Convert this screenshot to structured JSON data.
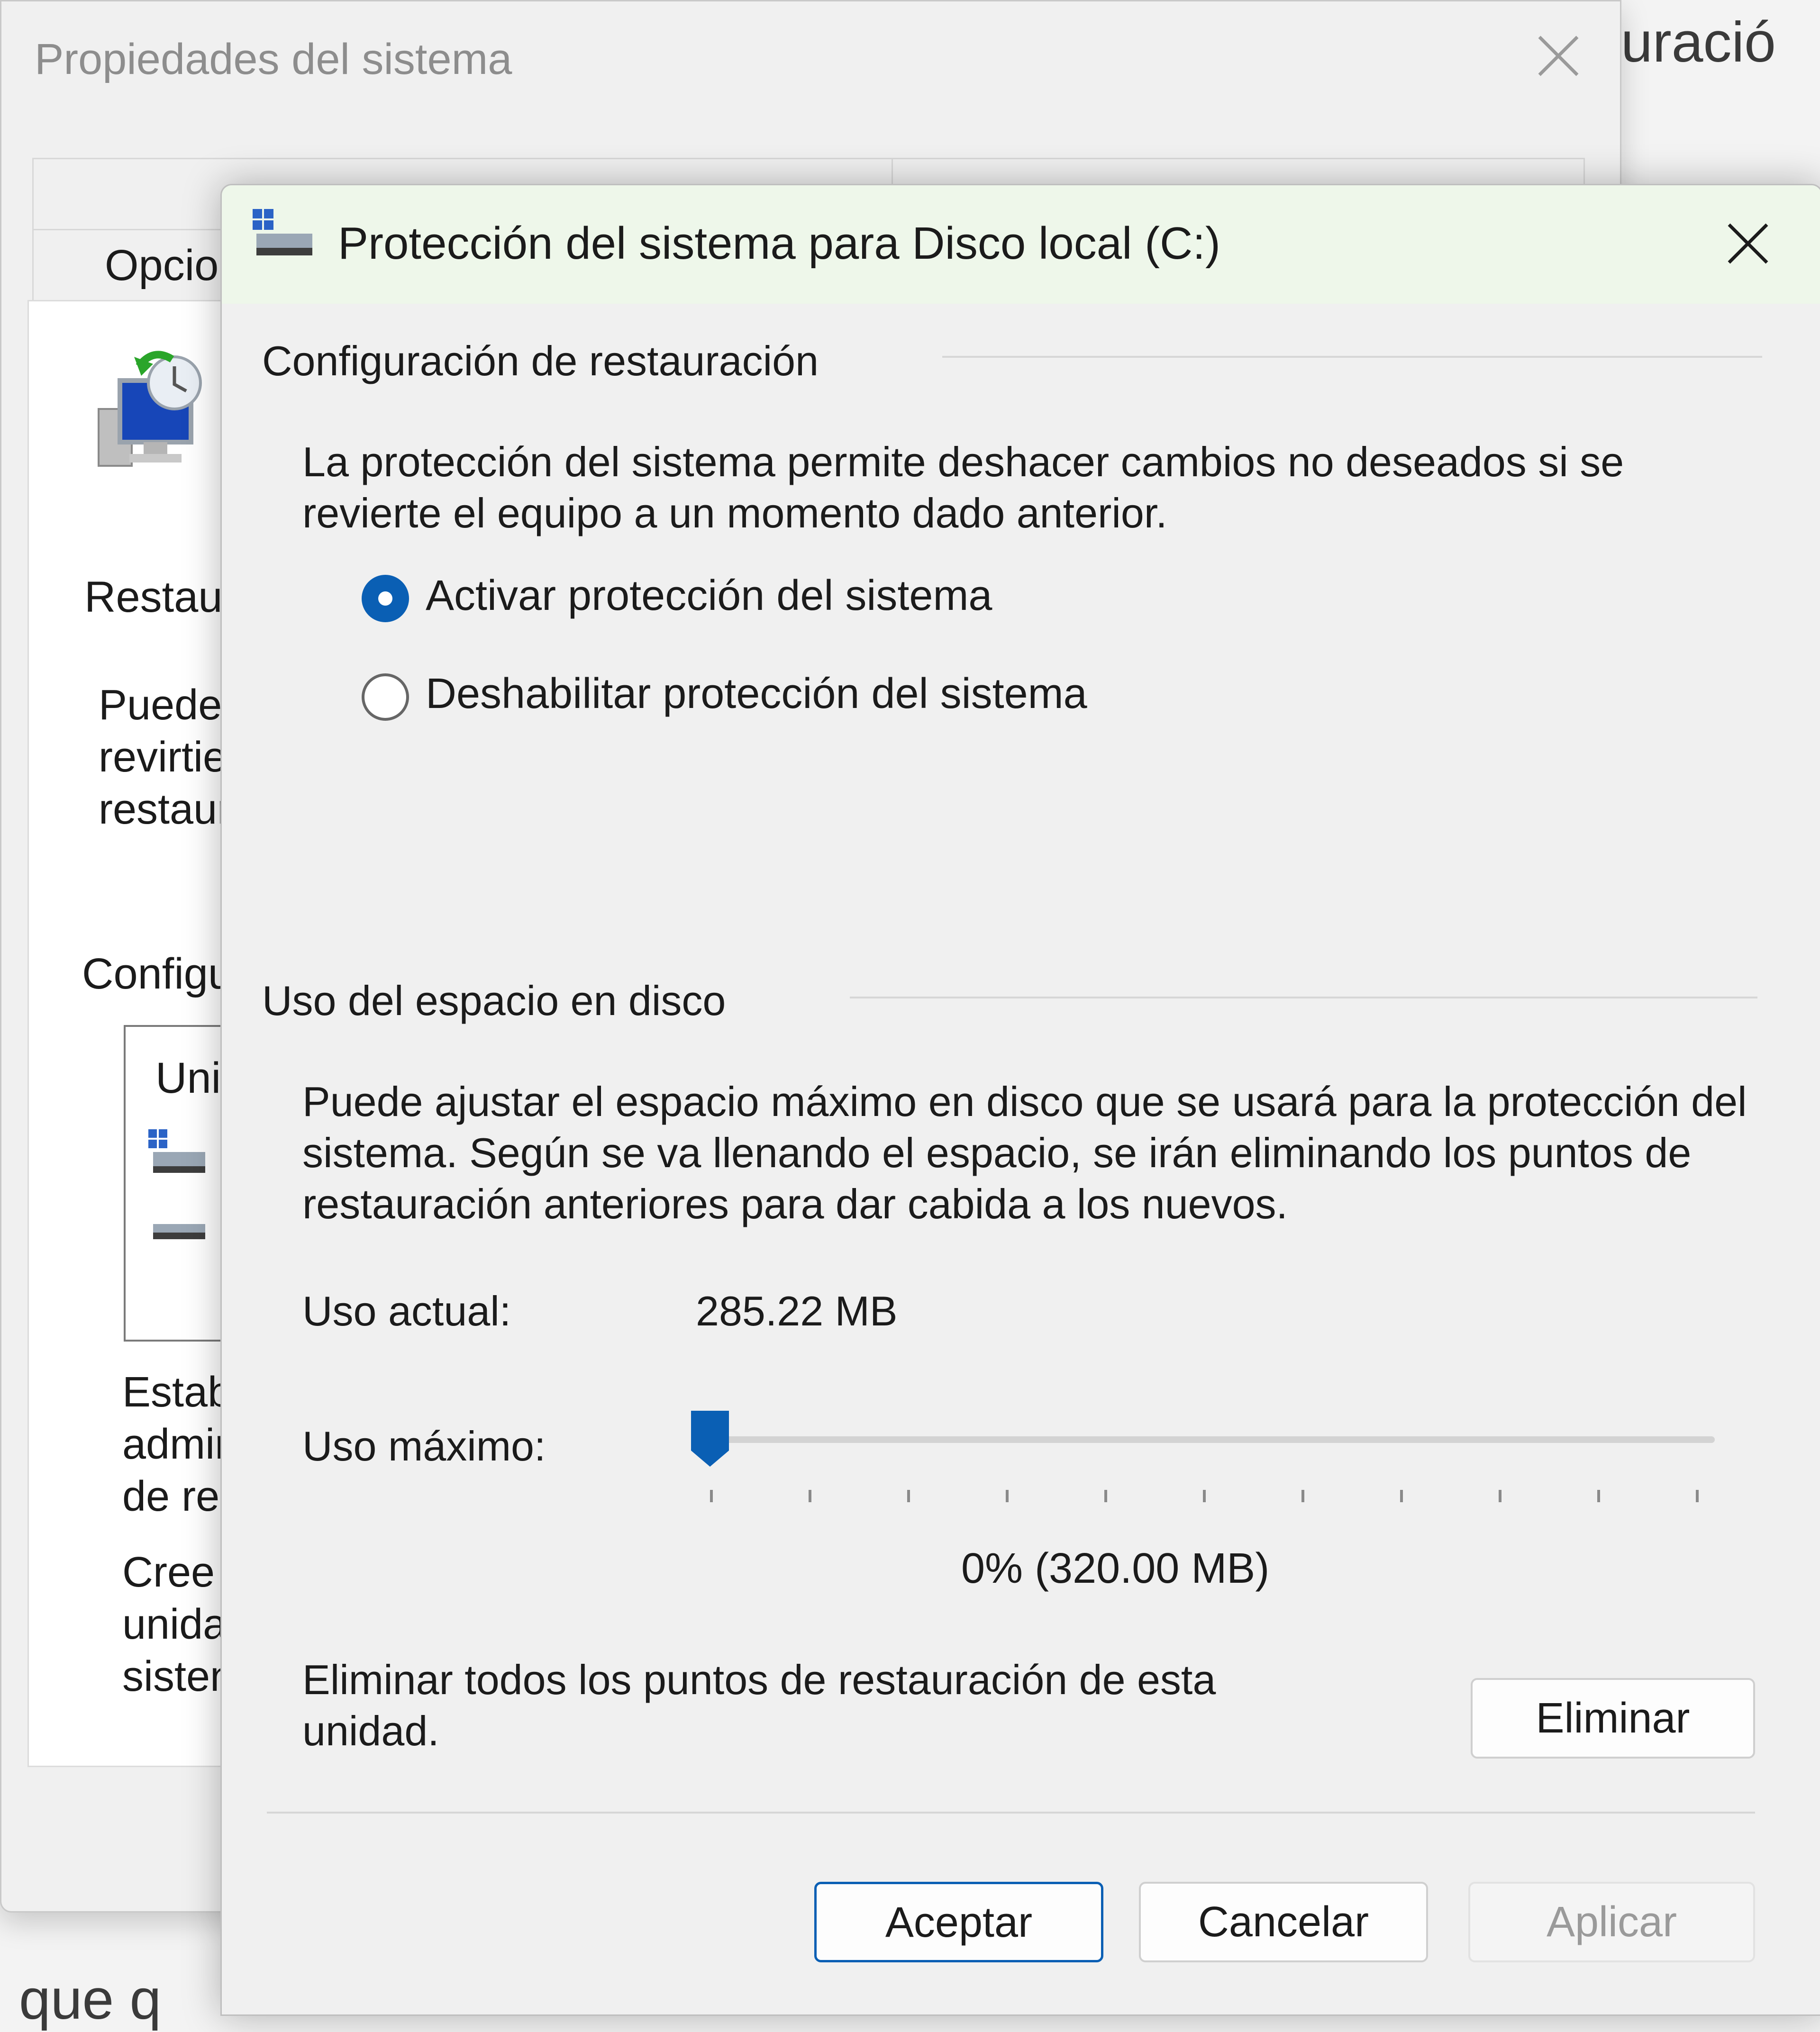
{
  "background": {
    "top_right_text": "uració",
    "bottom_left_text": "que q"
  },
  "parent_window": {
    "title": "Propiedades del sistema",
    "tab_opciones_fragment": "Opcion",
    "restaurar_fragment": "Restau",
    "puede_fragment": "Puede\nrevirtie\nrestaur",
    "config_fragment": "Configu",
    "list_header_fragment": "Uni",
    "estab_fragment": "Estab\nadmir\nde re",
    "cree_fragment": "Cree\nunida\nsisten",
    "icons": [
      "system-restore-icon",
      "drive-icon",
      "drive-icon",
      "close-icon"
    ]
  },
  "dialog": {
    "title": "Protección del sistema para Disco local (C:)",
    "titlebar_color": "#eef7ea",
    "restore_settings": {
      "group_title": "Configuración de restauración",
      "description": "La protección del sistema permite deshacer cambios no deseados si se revierte el equipo a un momento dado anterior.",
      "options": [
        {
          "label": "Activar protección del sistema",
          "selected": true
        },
        {
          "label": "Deshabilitar protección del sistema",
          "selected": false
        }
      ]
    },
    "disk_usage": {
      "group_title": "Uso del espacio en disco",
      "description": "Puede ajustar el espacio máximo en disco que se usará para la protección del sistema. Según se va llenando el espacio, se irán eliminando los puntos de restauración anteriores para dar cabida a los nuevos.",
      "current_label": "Uso actual:",
      "current_value": "285.22 MB",
      "max_label": "Uso máximo:",
      "slider_percent": 0,
      "slider_ticks": 11,
      "slider_value_text": "0% (320.00 MB)",
      "delete_text": "Eliminar todos los puntos de restauración de esta unidad.",
      "delete_button": "Eliminar"
    },
    "buttons": {
      "ok": "Aceptar",
      "cancel": "Cancelar",
      "apply": "Aplicar"
    },
    "accent_color": "#0a5fb4"
  }
}
